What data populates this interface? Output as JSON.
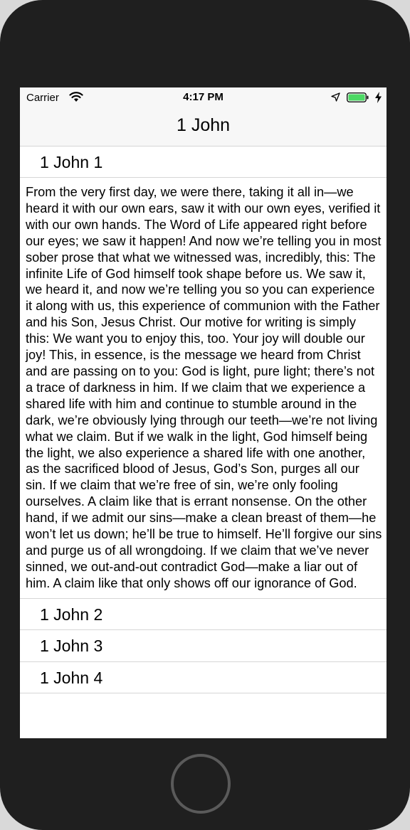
{
  "status_bar": {
    "carrier": "Carrier",
    "time": "4:17 PM",
    "icons": [
      "wifi-icon",
      "location-arrow-icon",
      "battery-icon",
      "charging-bolt-icon"
    ],
    "battery_color": "#4cd964"
  },
  "nav": {
    "title": "1 John"
  },
  "chapters": [
    {
      "label": "1 John 1",
      "expanded": true,
      "text": "From the very first day, we were there, taking it all in—we heard it with our own ears, saw it with our own eyes, verified it with our own hands. The Word of Life appeared right before our eyes; we saw it happen! And now we’re telling you in most sober prose that what we witnessed was, incredibly, this: The infinite Life of God himself took shape before us. We saw it, we heard it, and now we’re telling you so you can experience it along with us, this experience of communion with the Father and his Son, Jesus Christ. Our motive for writing is simply this: We want you to enjoy this, too. Your joy will double our joy! This, in essence, is the message we heard from Christ and are passing on to you: God is light, pure light; there’s not a trace of darkness in him. If we claim that we experience a shared life with him and continue to stumble around in the dark, we’re obviously lying through our teeth—we’re not living what we claim. But if we walk in the light, God himself being the light, we also experience a shared life with one another, as the sacrificed blood of Jesus, God’s Son, purges all our sin. If we claim that we’re free of sin, we’re only fooling ourselves. A claim like that is errant nonsense. On the other hand, if we admit our sins—make a clean breast of them—he won’t let us down; he’ll be true to himself. He’ll forgive our sins and purge us of all wrongdoing. If we claim that we’ve never sinned, we out-and-out contradict God—make a liar out of him. A claim like that only shows off our ignorance of God."
    },
    {
      "label": "1 John 2",
      "expanded": false
    },
    {
      "label": "1 John 3",
      "expanded": false
    },
    {
      "label": "1 John 4",
      "expanded": false
    }
  ]
}
